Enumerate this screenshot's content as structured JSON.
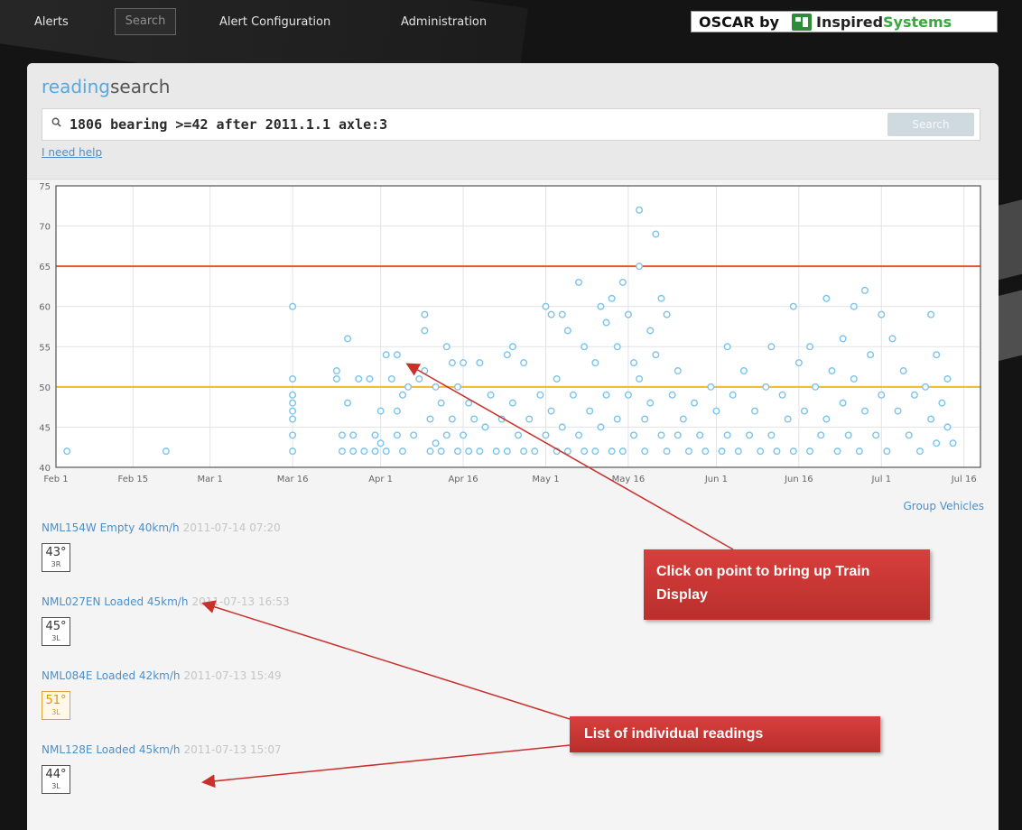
{
  "nav": {
    "alerts": "Alerts",
    "search": "Search",
    "alert_config": "Alert Configuration",
    "admin": "Administration",
    "brand_prefix": "OSCAR by",
    "brand_name_a": "Inspired",
    "brand_name_b": "Systems"
  },
  "header": {
    "title_highlight": "reading",
    "title_rest": "search",
    "query": "1806 bearing >=42 after 2011.1.1 axle:3",
    "search_button": "Search",
    "help_link": "I need help"
  },
  "group_link": "Group Vehicles",
  "readings": [
    {
      "title": "NML154W Empty 40km/h",
      "timestamp": "2011-07-14 07:20",
      "temp": "43°",
      "pos": "3R",
      "status": "normal"
    },
    {
      "title": "NML027EN Loaded 45km/h",
      "timestamp": "2011-07-13 16:53",
      "temp": "45°",
      "pos": "3L",
      "status": "normal"
    },
    {
      "title": "NML084E Loaded 42km/h",
      "timestamp": "2011-07-13 15:49",
      "temp": "51°",
      "pos": "3L",
      "status": "warning"
    },
    {
      "title": "NML128E Loaded 45km/h",
      "timestamp": "2011-07-13 15:07",
      "temp": "44°",
      "pos": "3L",
      "status": "normal"
    }
  ],
  "callouts": {
    "train_display_line1": "Click on point to bring up Train",
    "train_display_line2": "Display",
    "readings_list": "List of individual readings"
  },
  "chart_data": {
    "type": "scatter",
    "title": "",
    "xlabel": "",
    "ylabel": "",
    "ylim": [
      40,
      75
    ],
    "yticks": [
      40,
      45,
      50,
      55,
      60,
      65,
      70,
      75
    ],
    "x_domain": [
      "2011-02-01",
      "2011-07-19"
    ],
    "xtick_dates": [
      "2011-02-01",
      "2011-02-15",
      "2011-03-01",
      "2011-03-16",
      "2011-04-01",
      "2011-04-16",
      "2011-05-01",
      "2011-05-16",
      "2011-06-01",
      "2011-06-16",
      "2011-07-01",
      "2011-07-16"
    ],
    "xtick_labels": [
      "Feb 1",
      "Feb 15",
      "Mar 1",
      "Mar 16",
      "Apr 1",
      "Apr 16",
      "May 1",
      "May 16",
      "Jun 1",
      "Jun 16",
      "Jul 1",
      "Jul 16"
    ],
    "grid": true,
    "thresholds": [
      {
        "value": 65,
        "color": "#e4572e"
      },
      {
        "value": 50,
        "color": "#f0b92a"
      }
    ],
    "point_color": "#7cc4ea",
    "points": [
      [
        "2011-02-03",
        42
      ],
      [
        "2011-02-21",
        42
      ],
      [
        "2011-03-16",
        60
      ],
      [
        "2011-03-16",
        51
      ],
      [
        "2011-03-16",
        49
      ],
      [
        "2011-03-16",
        48
      ],
      [
        "2011-03-16",
        47
      ],
      [
        "2011-03-16",
        46
      ],
      [
        "2011-03-16",
        44
      ],
      [
        "2011-03-16",
        42
      ],
      [
        "2011-03-24",
        52
      ],
      [
        "2011-03-24",
        51
      ],
      [
        "2011-03-25",
        44
      ],
      [
        "2011-03-25",
        42
      ],
      [
        "2011-03-26",
        56
      ],
      [
        "2011-03-26",
        48
      ],
      [
        "2011-03-27",
        44
      ],
      [
        "2011-03-27",
        42
      ],
      [
        "2011-03-28",
        51
      ],
      [
        "2011-03-29",
        42
      ],
      [
        "2011-03-30",
        51
      ],
      [
        "2011-03-31",
        44
      ],
      [
        "2011-03-31",
        42
      ],
      [
        "2011-04-01",
        47
      ],
      [
        "2011-04-01",
        43
      ],
      [
        "2011-04-02",
        54
      ],
      [
        "2011-04-02",
        42
      ],
      [
        "2011-04-03",
        51
      ],
      [
        "2011-04-04",
        47
      ],
      [
        "2011-04-04",
        44
      ],
      [
        "2011-04-04",
        54
      ],
      [
        "2011-04-05",
        42
      ],
      [
        "2011-04-05",
        49
      ],
      [
        "2011-04-06",
        50
      ],
      [
        "2011-04-07",
        44
      ],
      [
        "2011-04-08",
        51
      ],
      [
        "2011-04-09",
        59
      ],
      [
        "2011-04-09",
        57
      ],
      [
        "2011-04-09",
        52
      ],
      [
        "2011-04-10",
        42
      ],
      [
        "2011-04-10",
        46
      ],
      [
        "2011-04-11",
        50
      ],
      [
        "2011-04-11",
        43
      ],
      [
        "2011-04-12",
        48
      ],
      [
        "2011-04-12",
        42
      ],
      [
        "2011-04-13",
        55
      ],
      [
        "2011-04-13",
        44
      ],
      [
        "2011-04-14",
        53
      ],
      [
        "2011-04-14",
        46
      ],
      [
        "2011-04-15",
        42
      ],
      [
        "2011-04-15",
        50
      ],
      [
        "2011-04-16",
        53
      ],
      [
        "2011-04-16",
        44
      ],
      [
        "2011-04-17",
        48
      ],
      [
        "2011-04-17",
        42
      ],
      [
        "2011-04-18",
        46
      ],
      [
        "2011-04-19",
        53
      ],
      [
        "2011-04-19",
        42
      ],
      [
        "2011-04-20",
        45
      ],
      [
        "2011-04-21",
        49
      ],
      [
        "2011-04-22",
        42
      ],
      [
        "2011-04-23",
        46
      ],
      [
        "2011-04-24",
        54
      ],
      [
        "2011-04-24",
        42
      ],
      [
        "2011-04-25",
        55
      ],
      [
        "2011-04-25",
        48
      ],
      [
        "2011-04-26",
        44
      ],
      [
        "2011-04-27",
        42
      ],
      [
        "2011-04-27",
        53
      ],
      [
        "2011-04-28",
        46
      ],
      [
        "2011-04-29",
        42
      ],
      [
        "2011-04-30",
        49
      ],
      [
        "2011-05-01",
        60
      ],
      [
        "2011-05-01",
        44
      ],
      [
        "2011-05-02",
        59
      ],
      [
        "2011-05-02",
        47
      ],
      [
        "2011-05-03",
        42
      ],
      [
        "2011-05-03",
        51
      ],
      [
        "2011-05-04",
        59
      ],
      [
        "2011-05-04",
        45
      ],
      [
        "2011-05-05",
        57
      ],
      [
        "2011-05-05",
        42
      ],
      [
        "2011-05-06",
        49
      ],
      [
        "2011-05-07",
        44
      ],
      [
        "2011-05-07",
        63
      ],
      [
        "2011-05-08",
        42
      ],
      [
        "2011-05-08",
        55
      ],
      [
        "2011-05-09",
        47
      ],
      [
        "2011-05-10",
        53
      ],
      [
        "2011-05-10",
        42
      ],
      [
        "2011-05-11",
        60
      ],
      [
        "2011-05-11",
        45
      ],
      [
        "2011-05-12",
        58
      ],
      [
        "2011-05-12",
        49
      ],
      [
        "2011-05-13",
        42
      ],
      [
        "2011-05-13",
        61
      ],
      [
        "2011-05-14",
        55
      ],
      [
        "2011-05-14",
        46
      ],
      [
        "2011-05-15",
        63
      ],
      [
        "2011-05-15",
        42
      ],
      [
        "2011-05-16",
        59
      ],
      [
        "2011-05-16",
        49
      ],
      [
        "2011-05-17",
        53
      ],
      [
        "2011-05-17",
        44
      ],
      [
        "2011-05-18",
        72
      ],
      [
        "2011-05-18",
        65
      ],
      [
        "2011-05-18",
        51
      ],
      [
        "2011-05-19",
        46
      ],
      [
        "2011-05-19",
        42
      ],
      [
        "2011-05-20",
        57
      ],
      [
        "2011-05-20",
        48
      ],
      [
        "2011-05-21",
        69
      ],
      [
        "2011-05-21",
        54
      ],
      [
        "2011-05-22",
        44
      ],
      [
        "2011-05-22",
        61
      ],
      [
        "2011-05-23",
        42
      ],
      [
        "2011-05-23",
        59
      ],
      [
        "2011-05-24",
        49
      ],
      [
        "2011-05-25",
        52
      ],
      [
        "2011-05-25",
        44
      ],
      [
        "2011-05-26",
        46
      ],
      [
        "2011-05-27",
        42
      ],
      [
        "2011-05-28",
        48
      ],
      [
        "2011-05-29",
        44
      ],
      [
        "2011-05-30",
        42
      ],
      [
        "2011-05-31",
        50
      ],
      [
        "2011-06-01",
        47
      ],
      [
        "2011-06-02",
        42
      ],
      [
        "2011-06-03",
        55
      ],
      [
        "2011-06-03",
        44
      ],
      [
        "2011-06-04",
        49
      ],
      [
        "2011-06-05",
        42
      ],
      [
        "2011-06-06",
        52
      ],
      [
        "2011-06-07",
        44
      ],
      [
        "2011-06-08",
        47
      ],
      [
        "2011-06-09",
        42
      ],
      [
        "2011-06-10",
        50
      ],
      [
        "2011-06-11",
        55
      ],
      [
        "2011-06-11",
        44
      ],
      [
        "2011-06-12",
        42
      ],
      [
        "2011-06-13",
        49
      ],
      [
        "2011-06-14",
        46
      ],
      [
        "2011-06-15",
        60
      ],
      [
        "2011-06-15",
        42
      ],
      [
        "2011-06-16",
        53
      ],
      [
        "2011-06-17",
        47
      ],
      [
        "2011-06-18",
        55
      ],
      [
        "2011-06-18",
        42
      ],
      [
        "2011-06-19",
        50
      ],
      [
        "2011-06-20",
        44
      ],
      [
        "2011-06-21",
        61
      ],
      [
        "2011-06-21",
        46
      ],
      [
        "2011-06-22",
        52
      ],
      [
        "2011-06-23",
        42
      ],
      [
        "2011-06-24",
        56
      ],
      [
        "2011-06-24",
        48
      ],
      [
        "2011-06-25",
        44
      ],
      [
        "2011-06-26",
        60
      ],
      [
        "2011-06-26",
        51
      ],
      [
        "2011-06-27",
        42
      ],
      [
        "2011-06-28",
        62
      ],
      [
        "2011-06-28",
        47
      ],
      [
        "2011-06-29",
        54
      ],
      [
        "2011-06-30",
        44
      ],
      [
        "2011-07-01",
        59
      ],
      [
        "2011-07-01",
        49
      ],
      [
        "2011-07-02",
        42
      ],
      [
        "2011-07-03",
        56
      ],
      [
        "2011-07-04",
        47
      ],
      [
        "2011-07-05",
        52
      ],
      [
        "2011-07-06",
        44
      ],
      [
        "2011-07-07",
        49
      ],
      [
        "2011-07-08",
        42
      ],
      [
        "2011-07-09",
        50
      ],
      [
        "2011-07-10",
        59
      ],
      [
        "2011-07-10",
        46
      ],
      [
        "2011-07-11",
        54
      ],
      [
        "2011-07-11",
        43
      ],
      [
        "2011-07-12",
        48
      ],
      [
        "2011-07-13",
        51
      ],
      [
        "2011-07-13",
        45
      ],
      [
        "2011-07-14",
        43
      ]
    ]
  }
}
